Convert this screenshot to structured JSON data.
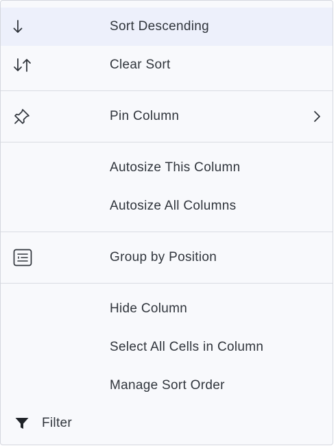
{
  "menu": {
    "sort_desc": {
      "label": "Sort Descending",
      "icon": "arrow-down-icon"
    },
    "clear_sort": {
      "label": "Clear Sort",
      "icon": "sort-arrows-icon"
    },
    "pin_column": {
      "label": "Pin Column",
      "icon": "pin-icon",
      "submenu_icon": "chevron-right-icon"
    },
    "autosize_this": {
      "label": "Autosize This Column"
    },
    "autosize_all": {
      "label": "Autosize All Columns"
    },
    "group_by": {
      "label": "Group by Position",
      "icon": "group-icon"
    },
    "hide_column": {
      "label": "Hide Column"
    },
    "select_all_cells": {
      "label": "Select All Cells in Column"
    },
    "manage_sort": {
      "label": "Manage Sort Order"
    },
    "filter": {
      "label": "Filter",
      "icon": "filter-icon"
    }
  },
  "colors": {
    "menu_bg": "#f8f9fc",
    "active_bg": "#edf0fb",
    "text": "#2f343b",
    "separator": "#d9dce2"
  }
}
